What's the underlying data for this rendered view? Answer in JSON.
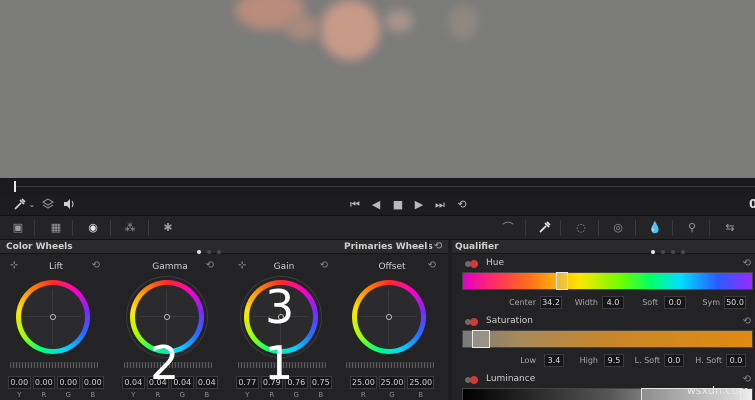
{
  "colors": {
    "accent": "#d23a3a",
    "panel": "#232326",
    "viewer": "#7c7c7b"
  },
  "transport": {
    "timecode_partial": "0"
  },
  "icons": [
    "eyedropper-icon",
    "layers-icon",
    "speaker-icon",
    "skip-back-icon",
    "step-back-icon",
    "stop-icon",
    "play-icon",
    "skip-forward-icon",
    "loop-icon"
  ],
  "color_wheels": {
    "title": "Color Wheels",
    "mode": "Primaries Wheels",
    "wheels": [
      {
        "label": "Lift",
        "values": [
          "0.00",
          "0.00",
          "0.00",
          "0.00"
        ]
      },
      {
        "label": "Gamma",
        "values": [
          "0.04",
          "0.04",
          "0.04",
          "0.04"
        ]
      },
      {
        "label": "Gain",
        "values": [
          "0.77",
          "0.79",
          "0.76",
          "0.75"
        ]
      },
      {
        "label": "Offset",
        "values": [
          "25.00",
          "25.00",
          "25.00"
        ]
      }
    ],
    "channel_labels": [
      "Y",
      "R",
      "G",
      "B"
    ],
    "offset_channel_labels": [
      "R",
      "G",
      "B"
    ]
  },
  "overlay_numbers": {
    "one": "1",
    "two": "2",
    "three": "3"
  },
  "qualifier": {
    "title": "Qualifier",
    "hue": {
      "label": "Hue",
      "params": [
        {
          "label": "Center",
          "value": "34.2"
        },
        {
          "label": "Width",
          "value": "4.0"
        },
        {
          "label": "Soft",
          "value": "0.0"
        },
        {
          "label": "Sym",
          "value": "50.0"
        }
      ]
    },
    "saturation": {
      "label": "Saturation",
      "params": [
        {
          "label": "Low",
          "value": "3.4"
        },
        {
          "label": "High",
          "value": "9.5"
        },
        {
          "label": "L. Soft",
          "value": "0.0"
        },
        {
          "label": "H. Soft",
          "value": "0.0"
        }
      ]
    },
    "luminance": {
      "label": "Luminance"
    }
  },
  "watermark": "wsxdn.com"
}
